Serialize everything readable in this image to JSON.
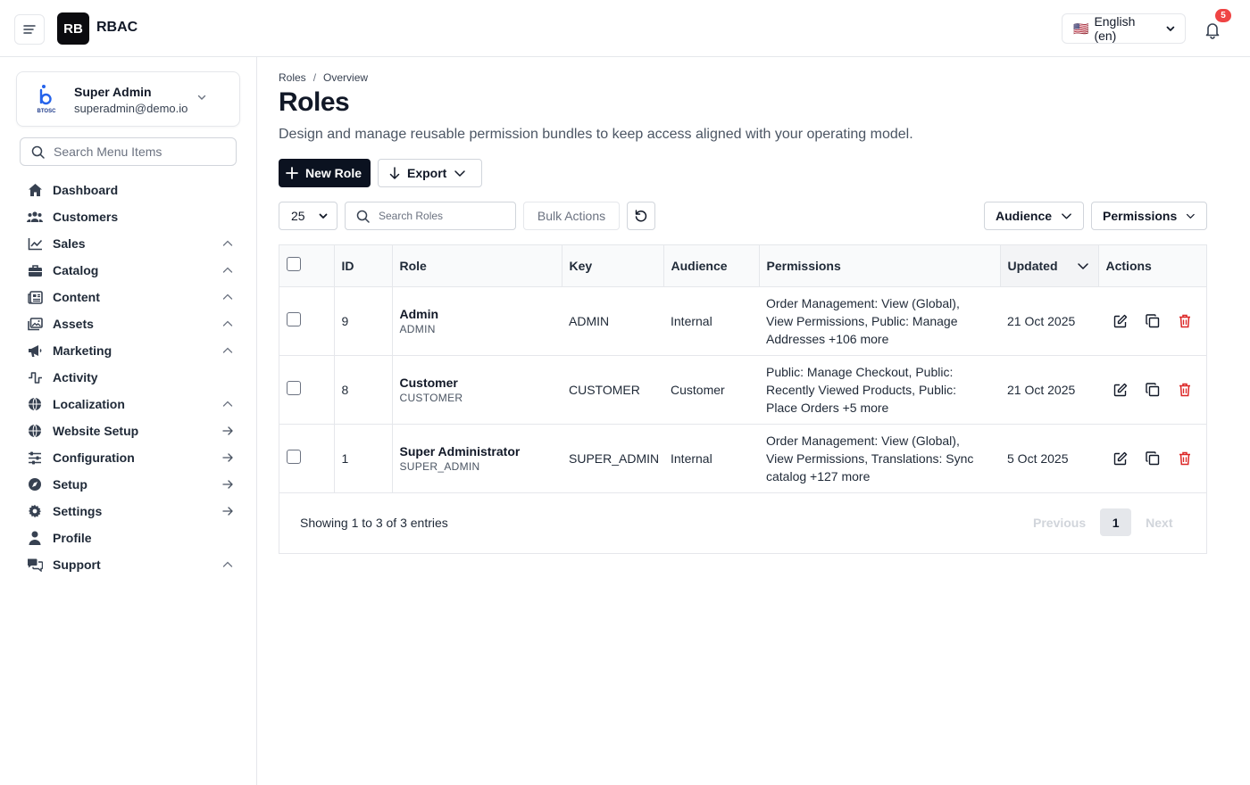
{
  "header": {
    "logo_text": "RB",
    "app_title": "RBAC",
    "language": {
      "flag": "🇺🇸",
      "label": "English (en)"
    },
    "notifications_count": "5"
  },
  "sidebar": {
    "user": {
      "name": "Super Admin",
      "email": "superadmin@demo.io",
      "logo_text": "BTOSC"
    },
    "search_placeholder": "Search Menu Items",
    "items": [
      {
        "label": "Dashboard",
        "icon": "home-icon",
        "trail": "none"
      },
      {
        "label": "Customers",
        "icon": "users-icon",
        "trail": "none"
      },
      {
        "label": "Sales",
        "icon": "chart-line-icon",
        "trail": "chevron-up"
      },
      {
        "label": "Catalog",
        "icon": "briefcase-icon",
        "trail": "chevron-up"
      },
      {
        "label": "Content",
        "icon": "newspaper-icon",
        "trail": "chevron-up"
      },
      {
        "label": "Assets",
        "icon": "images-icon",
        "trail": "chevron-up"
      },
      {
        "label": "Marketing",
        "icon": "megaphone-icon",
        "trail": "chevron-up"
      },
      {
        "label": "Activity",
        "icon": "pulse-icon",
        "trail": "none"
      },
      {
        "label": "Localization",
        "icon": "globe-icon",
        "trail": "chevron-up"
      },
      {
        "label": "Website Setup",
        "icon": "globe-icon",
        "trail": "arrow-right"
      },
      {
        "label": "Configuration",
        "icon": "sliders-icon",
        "trail": "arrow-right"
      },
      {
        "label": "Setup",
        "icon": "compass-icon",
        "trail": "arrow-right"
      },
      {
        "label": "Settings",
        "icon": "gear-icon",
        "trail": "arrow-right"
      },
      {
        "label": "Profile",
        "icon": "person-icon",
        "trail": "none"
      },
      {
        "label": "Support",
        "icon": "chat-icon",
        "trail": "chevron-up"
      }
    ]
  },
  "main": {
    "breadcrumb": [
      "Roles",
      "Overview"
    ],
    "breadcrumb_sep": "/",
    "title": "Roles",
    "description": "Design and manage reusable permission bundles to keep access aligned with your operating model.",
    "new_button": "New Role",
    "export_button": "Export",
    "per_page": "25",
    "search_placeholder": "Search Roles",
    "bulk_actions": "Bulk Actions",
    "filter_audience": "Audience",
    "filter_permissions": "Permissions",
    "columns": [
      "ID",
      "Role",
      "Key",
      "Audience",
      "Permissions",
      "Updated",
      "Actions"
    ],
    "rows": [
      {
        "id": "9",
        "name": "Admin",
        "code": "ADMIN",
        "key": "ADMIN",
        "audience": "Internal",
        "permissions": "Order Management: View (Global), View Permissions, Public: Manage Addresses +106 more",
        "updated": "21 Oct 2025"
      },
      {
        "id": "8",
        "name": "Customer",
        "code": "CUSTOMER",
        "key": "CUSTOMER",
        "audience": "Customer",
        "permissions": "Public: Manage Checkout, Public: Recently Viewed Products, Public: Place Orders +5 more",
        "updated": "21 Oct 2025"
      },
      {
        "id": "1",
        "name": "Super Administrator",
        "code": "SUPER_ADMIN",
        "key": "SUPER_ADMIN",
        "audience": "Internal",
        "permissions": "Order Management: View (Global), View Permissions, Translations: Sync catalog +127 more",
        "updated": "5 Oct 2025"
      }
    ],
    "showing": "Showing 1 to 3 of 3 entries",
    "pager": {
      "previous": "Previous",
      "current": "1",
      "next": "Next"
    }
  },
  "colors": {
    "primary": "#0b1220",
    "badge": "#ef4444",
    "danger": "#dc2626",
    "border": "#e5e7eb"
  }
}
